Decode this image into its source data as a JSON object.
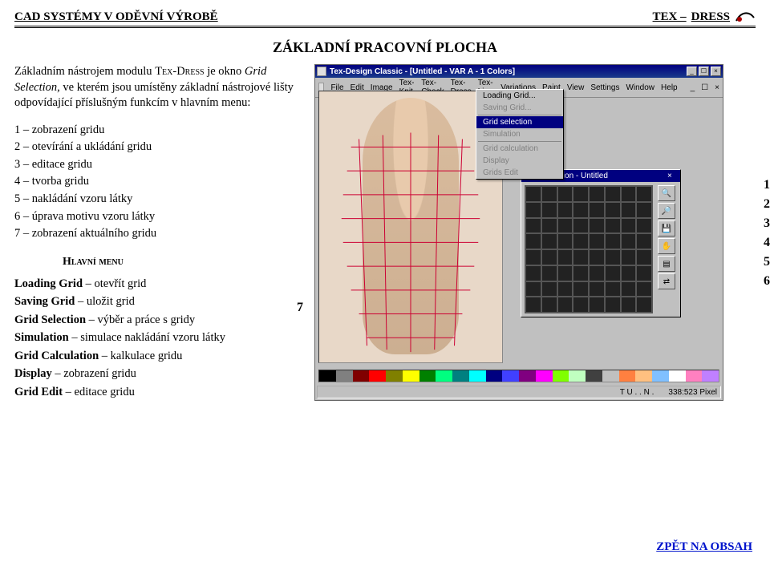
{
  "header": {
    "left": "CAD SYSTÉMY V ODĚVNÍ VÝROBĚ",
    "right_prefix": "TEX – ",
    "right_main": "DRESS"
  },
  "title": "ZÁKLADNÍ PRACOVNÍ PLOCHA",
  "intro": {
    "part1": "Základním nástrojem modulu ",
    "mod": "Tex-Dress",
    "part2": " je okno ",
    "win": "Grid Selection",
    "part3": ", ve kterém jsou umístěny základní nástrojové lišty odpovídající příslušným funkcím v hlavním menu:"
  },
  "numbered": [
    "1 – zobrazení gridu",
    "2 – otevírání a ukládání gridu",
    "3 – editace gridu",
    "4 – tvorba gridu",
    "5 – nakládání vzoru látky",
    "6 – úprava motivu vzoru látky",
    "7 – zobrazení aktuálního gridu"
  ],
  "submenu_heading": "Hlavní menu",
  "menu_desc": [
    {
      "b": "Loading Grid",
      "t": " – otevřít grid"
    },
    {
      "b": "Saving Grid",
      "t": " – uložit grid"
    },
    {
      "b": "Grid Selection",
      "t": " – výběr a práce s gridy"
    },
    {
      "b": "Simulation",
      "t": " – simulace nakládání vzoru látky"
    },
    {
      "b": "Grid Calculation",
      "t": " – kalkulace gridu"
    },
    {
      "b": "Display",
      "t": " – zobrazení gridu"
    },
    {
      "b": "Grid Edit",
      "t": " – editace gridu"
    }
  ],
  "app": {
    "title": "Tex-Design Classic - [Untitled - VAR A - 1 Colors]",
    "menubar": [
      "File",
      "Edit",
      "Image",
      "Tex-Knit",
      "Tex-Check",
      "Tex-Dress",
      "Tex-Line",
      "Variations",
      "Paint",
      "View",
      "Settings",
      "Window",
      "Help"
    ],
    "dropdown": [
      {
        "label": "Loading Grid...",
        "dis": false,
        "hl": false
      },
      {
        "label": "Saving Grid...",
        "dis": true,
        "hl": false
      },
      {
        "label": "Grid selection",
        "dis": false,
        "hl": true
      },
      {
        "label": "Simulation",
        "dis": true,
        "hl": false
      },
      {
        "label": "Grid calculation",
        "dis": true,
        "hl": false
      },
      {
        "label": "Display",
        "dis": true,
        "hl": false
      },
      {
        "label": "Grids Edit",
        "dis": true,
        "hl": false
      }
    ],
    "grid_panel_title": "Grid selection - Untitled",
    "status_left": "T U . . N .",
    "status_right": "338:523 Pixel",
    "palette": [
      "#000000",
      "#808080",
      "#800000",
      "#ff0000",
      "#808000",
      "#ffff00",
      "#008000",
      "#00ff80",
      "#008080",
      "#00ffff",
      "#000080",
      "#4040ff",
      "#800080",
      "#ff00ff",
      "#80ff00",
      "#c0ffc0",
      "#404040",
      "#c0c0c0",
      "#ff8040",
      "#ffc080",
      "#80c0ff",
      "#ffffff",
      "#ff80c0",
      "#c080ff"
    ],
    "tool_names": [
      "magnify-icon",
      "search-icon",
      "save-icon",
      "hand-icon",
      "layers-icon",
      "connect-icon"
    ]
  },
  "callouts": [
    "1",
    "2",
    "3",
    "4",
    "5",
    "6",
    "7"
  ],
  "back_link": "ZPĚT NA OBSAH"
}
